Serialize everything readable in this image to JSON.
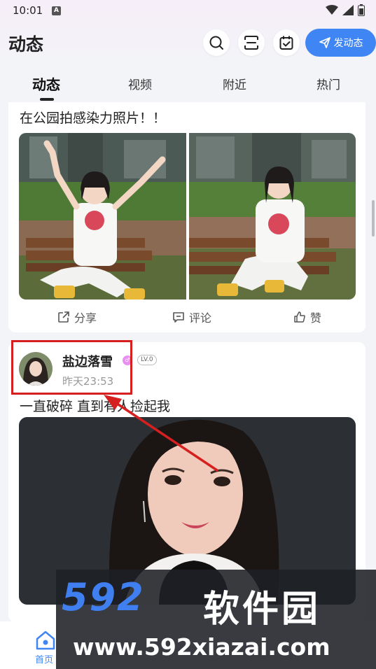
{
  "status_bar": {
    "time": "10:01",
    "indicator": "A",
    "icons": [
      "wifi-icon",
      "signal-icon",
      "battery-icon"
    ]
  },
  "header": {
    "title": "动态",
    "icon_buttons": [
      "search-icon",
      "scan-icon",
      "checkin-calendar-icon"
    ],
    "post_button_label": "发动态",
    "post_button_color": "#3f86f4"
  },
  "tabs": [
    {
      "label": "动态",
      "active": true
    },
    {
      "label": "视频",
      "active": false
    },
    {
      "label": "附近",
      "active": false
    },
    {
      "label": "热门",
      "active": false
    }
  ],
  "feed": {
    "post1": {
      "text": "在公园拍感染力照片！！",
      "photos": [
        "girl-arms-raised-on-bench-photo",
        "girl-sitting-on-bench-photo"
      ],
      "actions": {
        "share": "分享",
        "comment": "评论",
        "like": "赞"
      }
    },
    "post2": {
      "username": "盐边落雪",
      "vip_badge": "♂",
      "level": "LV.0",
      "time": "昨天23:53",
      "text": "一直破碎 直到有人捡起我",
      "photo": "girl-portrait-photo"
    }
  },
  "annotation_color": "#d62020",
  "bottom_nav": {
    "home_label": "首页",
    "active_color": "#3f86f4"
  },
  "watermark": {
    "brand": "592",
    "brand_cn": "软件园",
    "url": "www.592xiazai.com"
  }
}
